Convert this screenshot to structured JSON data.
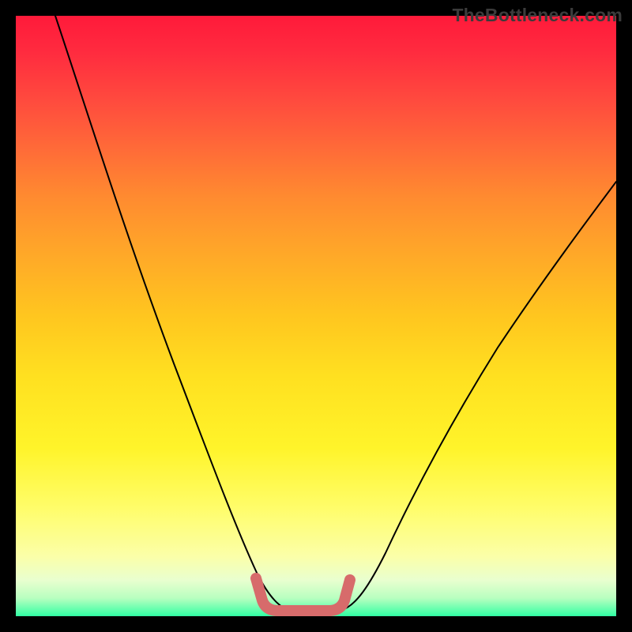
{
  "watermark": "TheBottleneck.com",
  "chart_data": {
    "type": "line",
    "title": "",
    "xlabel": "",
    "ylabel": "",
    "xlim": [
      0,
      100
    ],
    "ylim": [
      0,
      100
    ],
    "grid": false,
    "legend": false,
    "series": [
      {
        "name": "curve",
        "x": [
          0,
          5,
          10,
          15,
          20,
          25,
          30,
          35,
          38,
          40,
          42,
          44,
          46,
          48,
          50,
          52,
          54,
          58,
          62,
          68,
          74,
          80,
          86,
          92,
          100
        ],
        "y": [
          100,
          90,
          80,
          70,
          60,
          50,
          40,
          30,
          22,
          15,
          10,
          6,
          3,
          1.5,
          1,
          1.5,
          3,
          8,
          15,
          24,
          33,
          42,
          51,
          60,
          72
        ]
      }
    ],
    "marker": {
      "name": "bottleneck-range",
      "x_start": 40,
      "x_end": 54,
      "y": 2,
      "color": "#d76b6b"
    },
    "background_gradient": {
      "top": "#ff1a3a",
      "bottom": "#30ffa3"
    }
  }
}
